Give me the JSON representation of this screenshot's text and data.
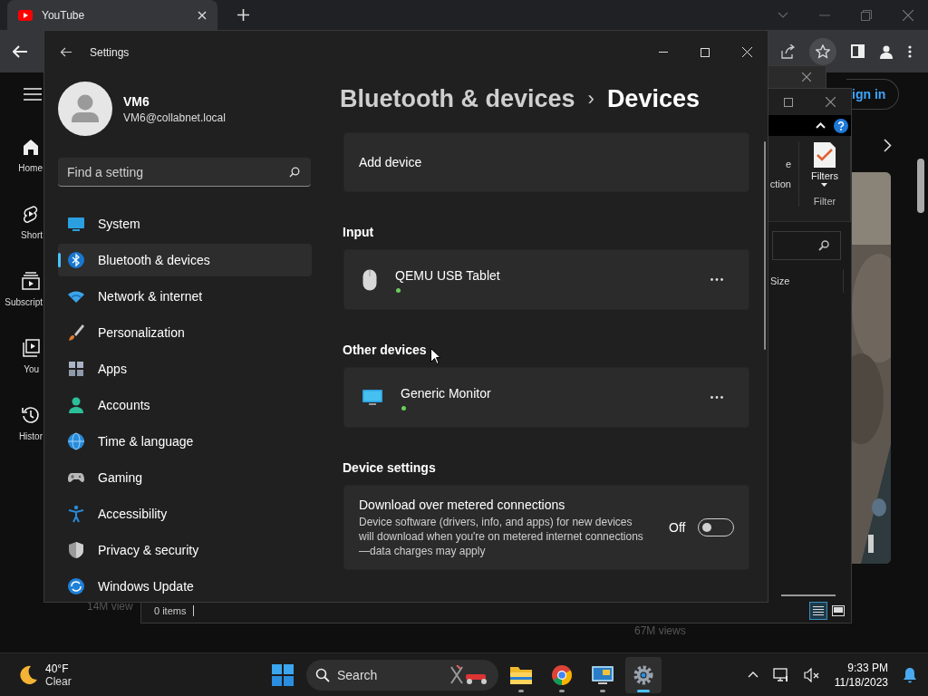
{
  "browser": {
    "tabs": [
      {
        "title": "YouTube",
        "selected": true
      }
    ]
  },
  "youtube": {
    "sidebar": [
      {
        "kind": "home",
        "label": "Home"
      },
      {
        "kind": "shorts",
        "label": "Short"
      },
      {
        "kind": "subscriptions",
        "label": "Subscript"
      },
      {
        "kind": "you",
        "label": "You"
      },
      {
        "kind": "history",
        "label": "Histor"
      }
    ],
    "sign_in": "ign in",
    "views": [
      "14M view",
      "67M views"
    ]
  },
  "explorer": {
    "ribbon_text": [
      "e",
      "ction"
    ],
    "filters_button": "Filters",
    "group_label": "Filter",
    "column": "Size",
    "status": "0 items"
  },
  "settings": {
    "title": "Settings",
    "user": {
      "name": "VM6",
      "email": "VM6@collabnet.local"
    },
    "search": {
      "placeholder": "Find a setting"
    },
    "nav": [
      {
        "kind": "system",
        "label": "System",
        "selected": false
      },
      {
        "kind": "bluetooth",
        "label": "Bluetooth & devices",
        "selected": true
      },
      {
        "kind": "network",
        "label": "Network & internet",
        "selected": false
      },
      {
        "kind": "brush",
        "label": "Personalization",
        "selected": false
      },
      {
        "kind": "apps",
        "label": "Apps",
        "selected": false
      },
      {
        "kind": "accounts",
        "label": "Accounts",
        "selected": false
      },
      {
        "kind": "time",
        "label": "Time & language",
        "selected": false
      },
      {
        "kind": "gaming",
        "label": "Gaming",
        "selected": false
      },
      {
        "kind": "accessibility",
        "label": "Accessibility",
        "selected": false
      },
      {
        "kind": "shield",
        "label": "Privacy & security",
        "selected": false
      },
      {
        "kind": "update",
        "label": "Windows Update",
        "selected": false
      }
    ],
    "breadcrumb": {
      "parent": "Bluetooth & devices",
      "separator": "›",
      "current": "Devices"
    },
    "sections": [
      {
        "kind": "card",
        "title": "Add device"
      },
      {
        "kind": "heading",
        "title": "Input"
      },
      {
        "kind": "mouse",
        "name": "QEMU USB Tablet",
        "connected": true
      },
      {
        "kind": "heading",
        "title": "Other devices"
      },
      {
        "kind": "monitor",
        "name": "Generic Monitor",
        "connected": true
      },
      {
        "kind": "heading",
        "title": "Device settings"
      },
      {
        "kind": "toggle",
        "title": "Download over metered connections",
        "description": "Device software (drivers, info, and apps) for new devices will download when you're on metered internet connections—data charges may apply",
        "state_label": "Off",
        "on": false
      }
    ]
  },
  "taskbar": {
    "weather": {
      "temperature": "40°F",
      "condition": "Clear"
    },
    "search": {
      "placeholder": "Search"
    },
    "apps": [
      {
        "kind": "folder",
        "selected": false
      },
      {
        "kind": "chrome",
        "selected": false
      },
      {
        "kind": "monitor",
        "selected": false
      },
      {
        "kind": "gear",
        "selected": true
      }
    ],
    "time": "9:33 PM",
    "date": "11/18/2023"
  }
}
